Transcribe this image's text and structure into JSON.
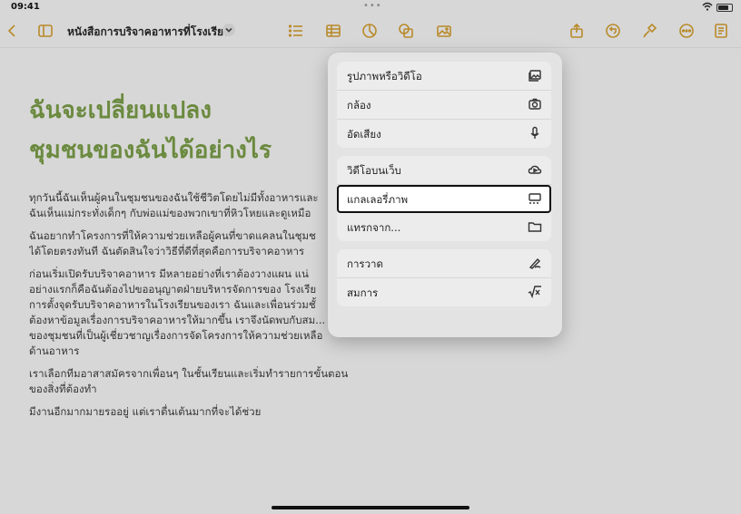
{
  "status": {
    "time": "09:41"
  },
  "toolbar": {
    "doc_title": "หนังสือการบริจาคอาหารที่โรงเรียน",
    "accent": "#b98a2a"
  },
  "document": {
    "heading_line1": "ฉันจะเปลี่ยนแปลง",
    "heading_line2": "ชุมชนของฉันได้อย่างไร",
    "heading_color": "#6b8a3f",
    "p1_l1": "ทุกวันนี้ฉันเห็นผู้คนในชุมชนของฉันใช้ชีวิตโดยไม่มีทั้งอาหารและ",
    "p1_l2": "ฉันเห็นแม่กระทั่งเด็กๆ กับพ่อแม่ของพวกเขาที่หิวโหยและดูเหมือ",
    "p2_l1": "ฉันอยากทำโครงการที่ให้ความช่วยเหลือผู้คนที่ขาดแคลนในชุมช",
    "p2_l2": "ได้โดยตรงทันที ฉันตัดสินใจว่าวิธีที่ดีที่สุดคือการบริจาคอาหาร",
    "p3_l1": "ก่อนเริ่มเปิดรับบริจาคอาหาร มีหลายอย่างที่เราต้องวางแผน แน่",
    "p3_l2": "อย่างแรกก็คือฉันต้องไปขออนุญาตฝ่ายบริหารจัดการของ โรงเรีย",
    "p3_l3": "การตั้งจุดรับบริจาคอาหารในโรงเรียนของเรา ฉันและเพื่อนร่วมชั้",
    "p3_l4": "ต้องหาข้อมูลเรื่องการบริจาคอาหารให้มากขึ้น เราจึงนัดพบกับสม...",
    "p3_l5": "ของชุมชนที่เป็นผู้เชี่ยวชาญเรื่องการจัดโครงการให้ความช่วยเหลือ",
    "p3_l6": "ด้านอาหาร",
    "p4_l1": "เราเลือกทีมอาสาสมัครจากเพื่อนๆ ในชั้นเรียนและเริ่มทำรายการขั้นตอน",
    "p4_l2": "ของสิ่งที่ต้องทำ",
    "p5_l1": "มีงานอีกมากมายรออยู่ แต่เราตื่นเต้นมากที่จะได้ช่วย"
  },
  "menu": {
    "photo_video": "รูปภาพหรือวิดีโอ",
    "camera": "กล้อง",
    "record_audio": "อัดเสียง",
    "web_video": "วิดีโอบนเว็บ",
    "image_gallery": "แกลเลอรี่ภาพ",
    "insert_from": "แทรกจาก...",
    "drawing": "การวาด",
    "equation": "สมการ"
  }
}
